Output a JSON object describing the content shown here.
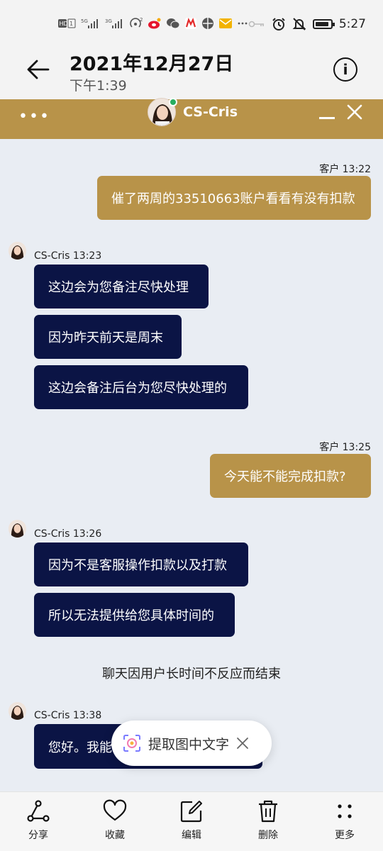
{
  "status_bar": {
    "time": "5:27",
    "icons": [
      "hd-signal-icon",
      "5g-signal-icon",
      "3g-signal-icon",
      "hotspot-icon",
      "weibo-icon",
      "wechat-icon",
      "app-icon",
      "app-icon",
      "mail-icon",
      "more-icon",
      "key-icon",
      "alarm-icon",
      "mute-icon",
      "battery-icon"
    ],
    "battery_level": 0.9
  },
  "viewer": {
    "date": "2021年12月27日",
    "time": "下午1:39"
  },
  "chat": {
    "agent_name": "CS-Cris",
    "messages": [
      {
        "sender": "user",
        "meta": "客户 13:22",
        "bubbles": [
          "催了两周的33510663账户看看有没有扣款"
        ]
      },
      {
        "sender": "agent",
        "meta": "CS-Cris 13:23",
        "bubbles": [
          "这边会为您备注尽快处理",
          "因为昨天前天是周末",
          "这边会备注后台为您尽快处理的"
        ]
      },
      {
        "sender": "user",
        "meta": "客户 13:25",
        "bubbles": [
          "今天能不能完成扣款?"
        ]
      },
      {
        "sender": "agent",
        "meta": "CS-Cris 13:26",
        "bubbles": [
          "因为不是客服操作扣款以及打款",
          "所以无法提供给您具体时间的"
        ]
      },
      {
        "sender": "system",
        "text": "聊天因用户长时间不反应而结束"
      },
      {
        "sender": "agent",
        "meta": "CS-Cris 13:38",
        "bubbles": [
          "您好。我能"
        ]
      }
    ]
  },
  "ocr_pill": {
    "label": "提取图中文字"
  },
  "actions": [
    {
      "label": "分享",
      "icon": "share-icon"
    },
    {
      "label": "收藏",
      "icon": "heart-icon"
    },
    {
      "label": "编辑",
      "icon": "edit-icon"
    },
    {
      "label": "删除",
      "icon": "trash-icon"
    },
    {
      "label": "更多",
      "icon": "more-icon"
    }
  ]
}
